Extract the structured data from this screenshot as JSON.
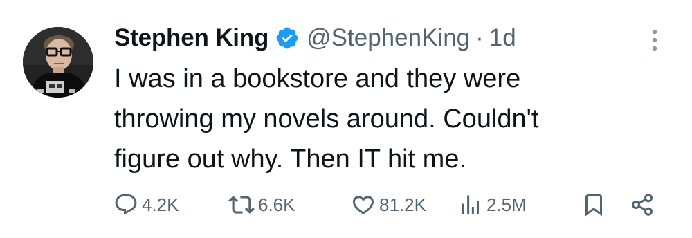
{
  "author": {
    "display_name": "Stephen King",
    "handle": "@StephenKing",
    "separator": "·",
    "time": "1d",
    "verified": true
  },
  "tweet": {
    "lines": [
      "I was in a bookstore and they were",
      "throwing my novels around. Couldn't",
      "figure out why. Then IT hit me."
    ]
  },
  "actions": {
    "replies": "4.2K",
    "reposts": "6.6K",
    "likes": "81.2K",
    "views": "2.5M"
  },
  "icons": {
    "verified": "verified-badge-icon",
    "more": "more-vertical-icon",
    "reply": "reply-bubble-icon",
    "repost": "repost-arrows-icon",
    "like": "heart-icon",
    "views": "bar-chart-icon",
    "bookmark": "bookmark-icon",
    "share": "share-icon"
  },
  "colors": {
    "text": "#0f1419",
    "secondary": "#536471",
    "verified": "#1d9bf0",
    "background": "#ffffff"
  }
}
